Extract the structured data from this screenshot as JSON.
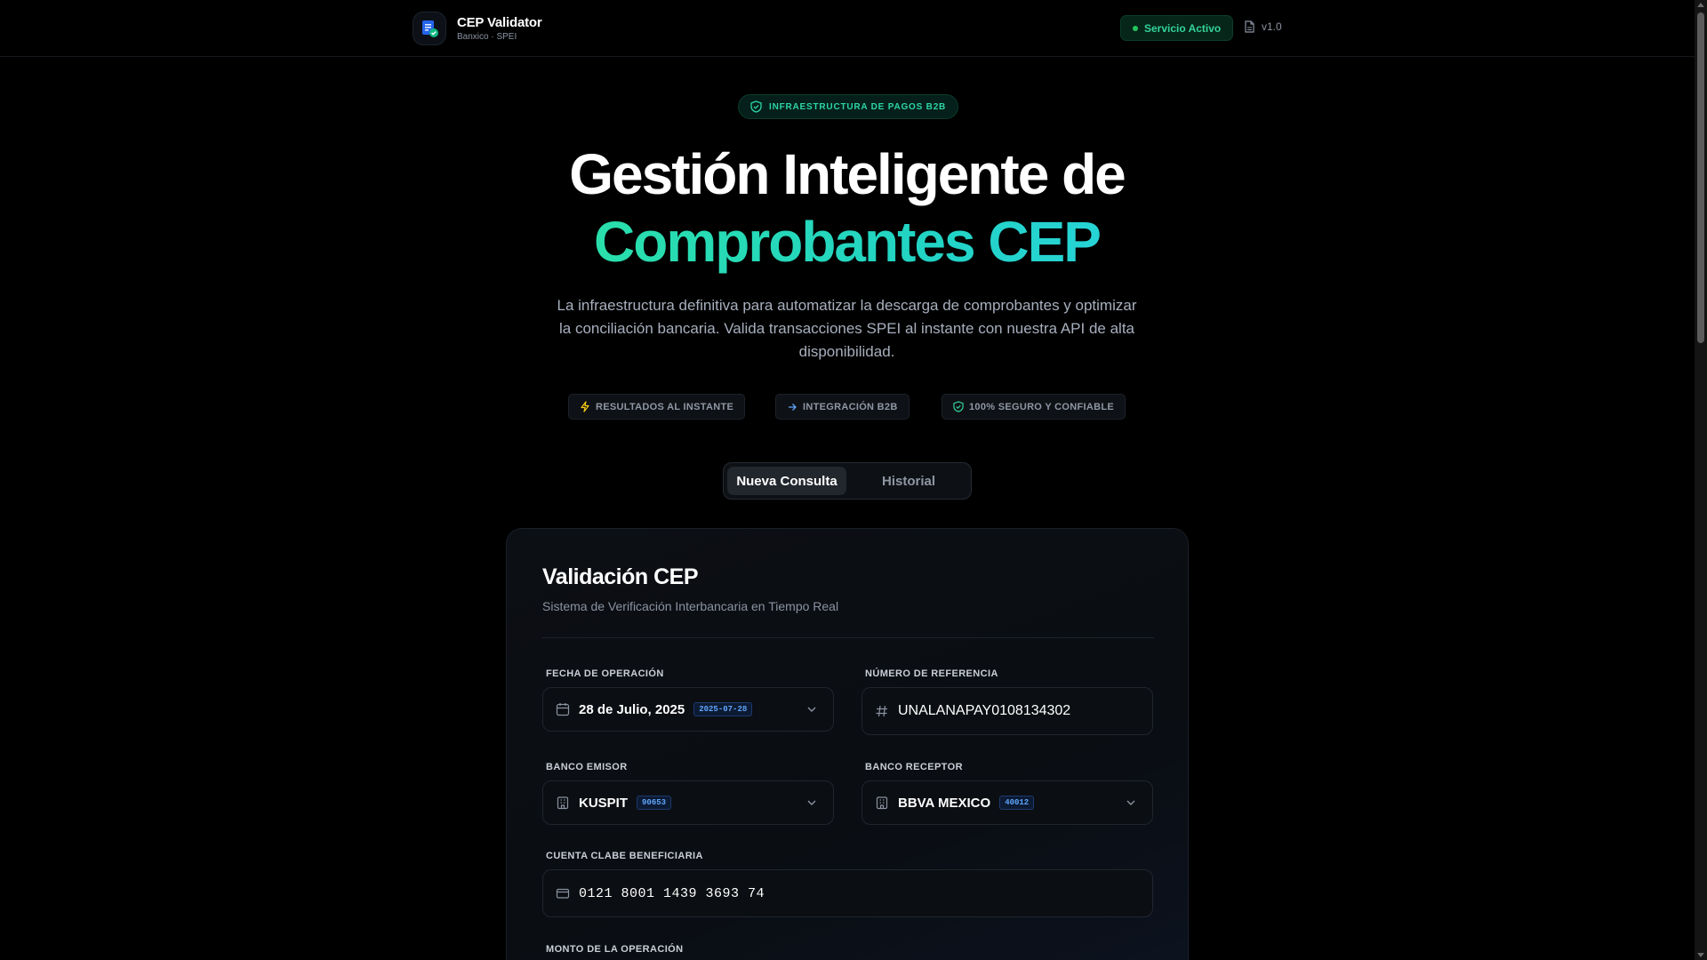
{
  "colors": {
    "background": "#000000",
    "accent_green": "#2ee59d",
    "accent_cyan": "#22d3c5",
    "badge_blue": "#60a5fa",
    "status_green": "#34d399"
  },
  "header": {
    "app_name": "CEP Validator",
    "app_subtitle": "Banxico · SPEI",
    "logo_icon": "document-check-icon",
    "status_label": "Servicio Activo",
    "version_label": "v1.0",
    "version_icon": "file-icon"
  },
  "hero": {
    "badge_label": "INFRAESTRUCTURA DE PAGOS B2B",
    "badge_icon": "shield-check-icon",
    "title_line1": "Gestión Inteligente de",
    "title_line2": "Comprobantes CEP",
    "description": "La infraestructura definitiva para automatizar la descarga de comprobantes y optimizar la conciliación bancaria. Valida transacciones SPEI al instante con nuestra API de alta disponibilidad.",
    "features": [
      {
        "label": "RESULTADOS AL INSTANTE",
        "icon": "bolt-icon"
      },
      {
        "label": "INTEGRACIÓN B2B",
        "icon": "arrow-right-icon"
      },
      {
        "label": "100% SEGURO Y CONFIABLE",
        "icon": "shield-check-icon"
      }
    ]
  },
  "tabs": {
    "active": "Nueva Consulta",
    "inactive": "Historial"
  },
  "form": {
    "title": "Validación CEP",
    "subtitle": "Sistema de Verificación Interbancaria en Tiempo Real",
    "fecha": {
      "label": "FECHA DE OPERACIÓN",
      "value": "28 de Julio, 2025",
      "iso": "2025-07-28",
      "icon": "calendar-icon"
    },
    "referencia": {
      "label": "NÚMERO DE REFERENCIA",
      "value": "UNALANAPAY0108134302",
      "icon": "hash-icon"
    },
    "emisor": {
      "label": "BANCO EMISOR",
      "value": "KUSPIT",
      "code": "90653",
      "icon": "bank-icon"
    },
    "receptor": {
      "label": "BANCO RECEPTOR",
      "value": "BBVA MEXICO",
      "code": "40012",
      "icon": "bank-icon"
    },
    "clabe": {
      "label": "CUENTA CLABE BENEFICIARIA",
      "value": "0121 8001 1439 3693 74",
      "icon": "credit-card-icon"
    },
    "monto": {
      "label": "MONTO DE LA OPERACIÓN"
    }
  }
}
